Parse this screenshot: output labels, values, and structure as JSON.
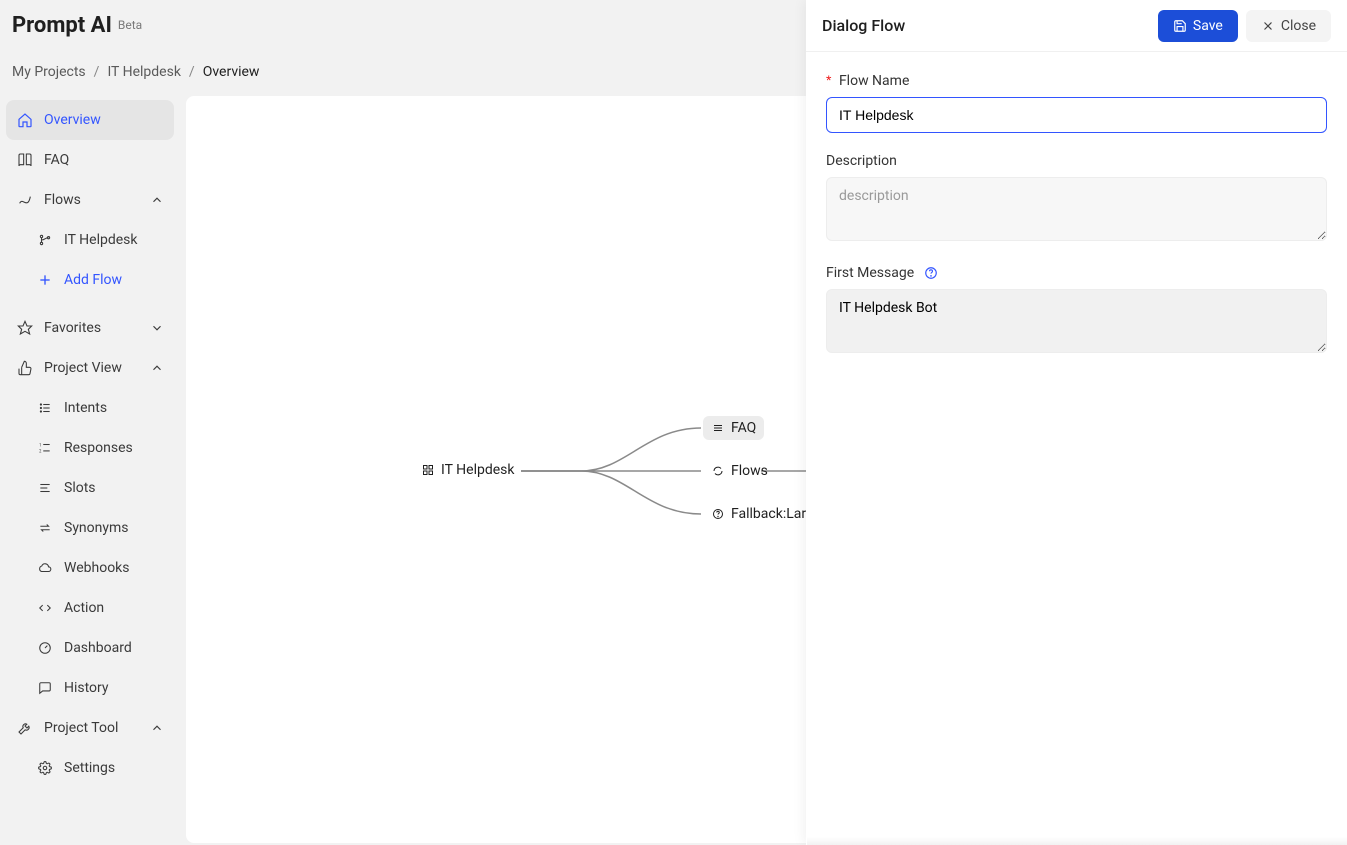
{
  "app": {
    "name": "Prompt AI",
    "badge": "Beta"
  },
  "breadcrumb": {
    "root": "My Projects",
    "project": "IT Helpdesk",
    "page": "Overview"
  },
  "sidebar": {
    "overview": "Overview",
    "faq": "FAQ",
    "flows": "Flows",
    "flow_items": [
      "IT Helpdesk"
    ],
    "add_flow": "Add Flow",
    "favorites": "Favorites",
    "project_view": "Project View",
    "project_view_items": [
      "Intents",
      "Responses",
      "Slots",
      "Synonyms",
      "Webhooks",
      "Action",
      "Dashboard",
      "History"
    ],
    "project_tool": "Project Tool",
    "project_tool_items": [
      "Settings"
    ]
  },
  "canvas": {
    "root_node": "IT Helpdesk",
    "children": [
      {
        "label": "FAQ",
        "highlight": true
      },
      {
        "label": "Flows",
        "highlight": false
      },
      {
        "label": "Fallback:Lar",
        "highlight": false
      }
    ]
  },
  "drawer": {
    "title": "Dialog Flow",
    "save": "Save",
    "close": "Close",
    "flow_name_label": "Flow Name",
    "flow_name_value": "IT Helpdesk",
    "description_label": "Description",
    "description_placeholder": "description",
    "first_message_label": "First Message",
    "first_message_value": "IT Helpdesk Bot"
  }
}
